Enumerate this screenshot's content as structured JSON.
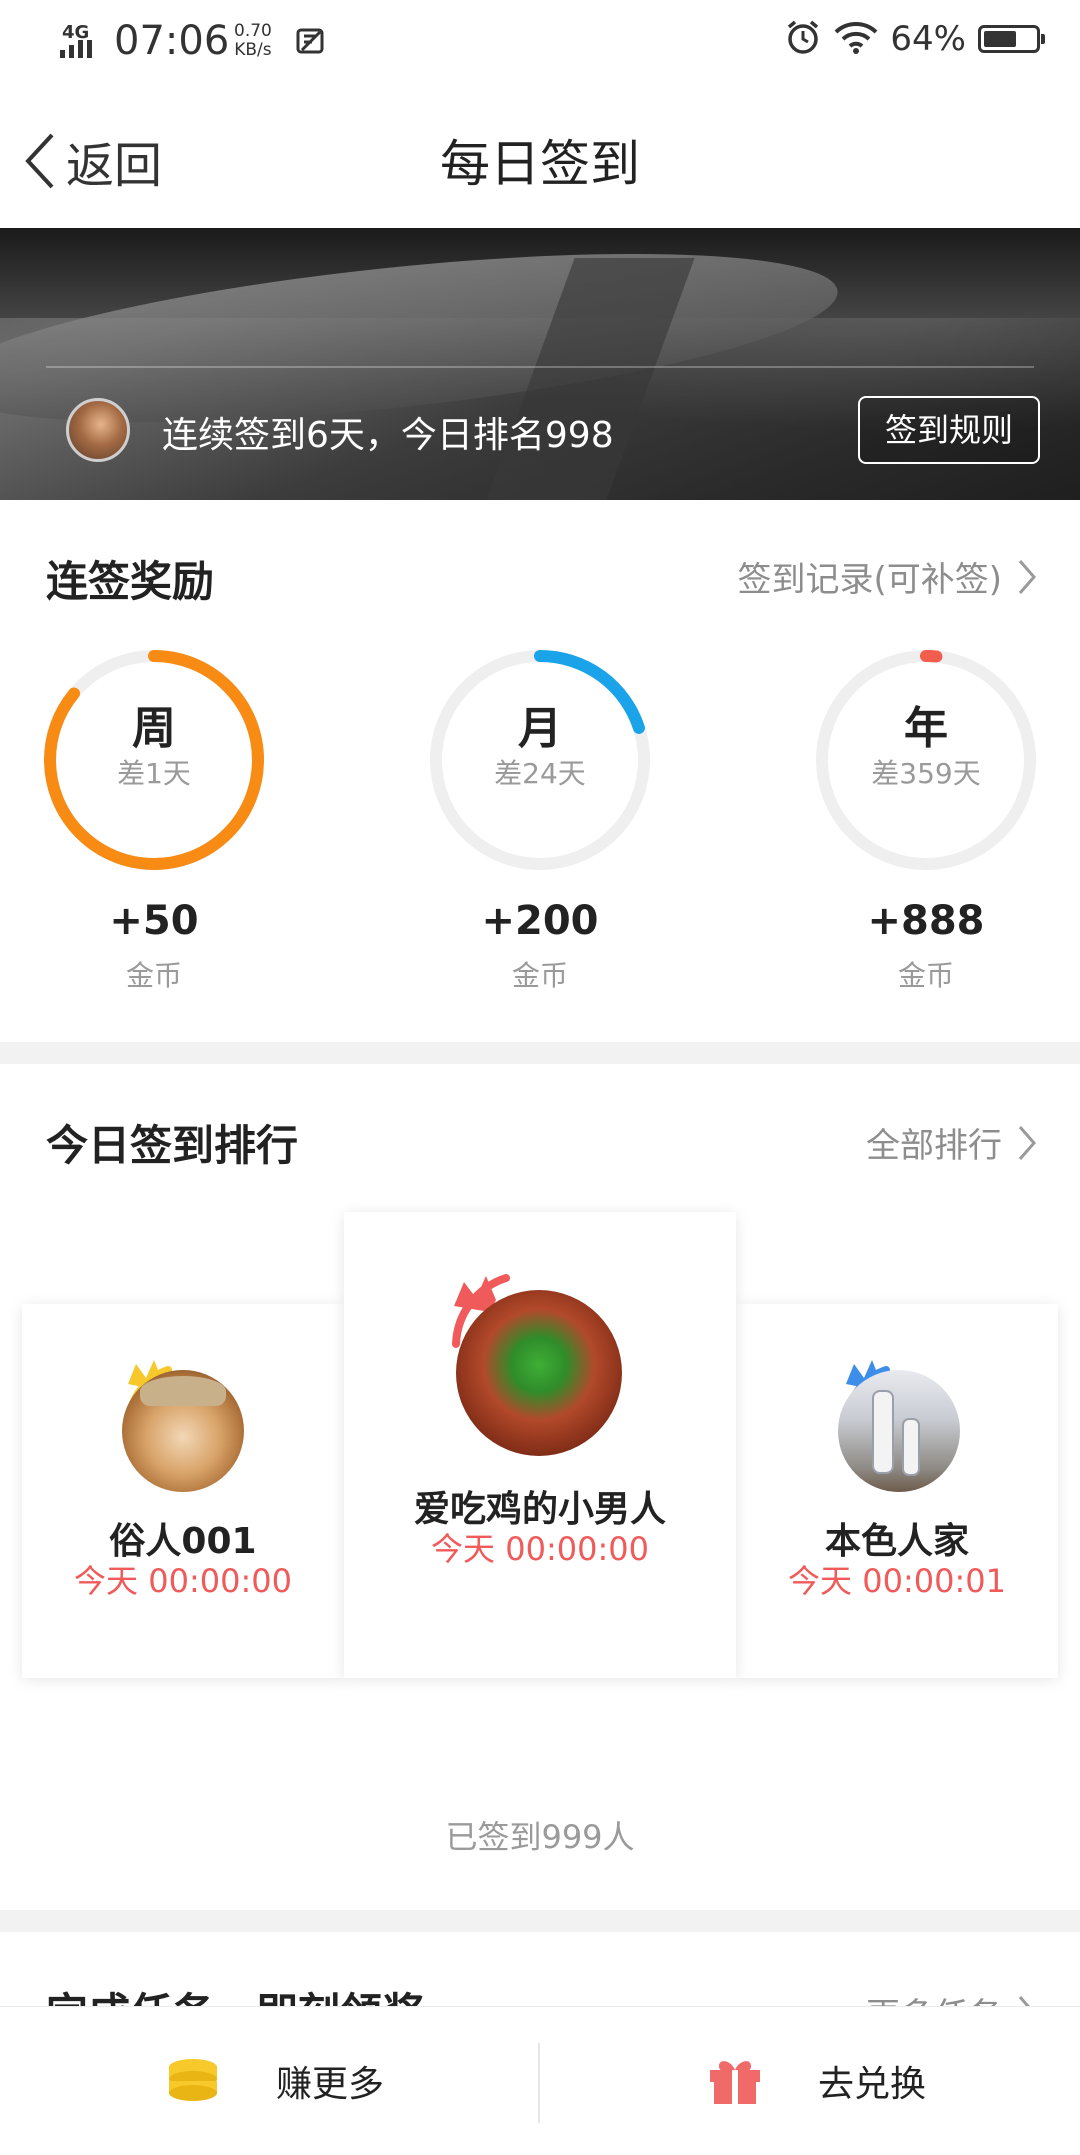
{
  "status_bar": {
    "network": "4G",
    "time": "07:06",
    "speed_value": "0.70",
    "speed_unit": "KB/s",
    "battery": "64%",
    "battery_level": 0.64
  },
  "nav": {
    "back_label": "返回",
    "title": "每日签到"
  },
  "banner": {
    "streak_text": "连续签到6天，今日排名998",
    "rules_button": "签到规则"
  },
  "rewards_section": {
    "title": "连签奖励",
    "link": "签到记录(可补签)",
    "items": [
      {
        "period": "周",
        "remaining": "差1天",
        "amount": "+50",
        "unit": "金币",
        "color": "#f78b14",
        "progress": 0.86
      },
      {
        "period": "月",
        "remaining": "差24天",
        "amount": "+200",
        "unit": "金币",
        "color": "#1aa3e8",
        "progress": 0.2
      },
      {
        "period": "年",
        "remaining": "差359天",
        "amount": "+888",
        "unit": "金币",
        "color": "#f25d4e",
        "progress": 0.016
      }
    ]
  },
  "ranking_section": {
    "title": "今日签到排行",
    "link": "全部排行",
    "first": {
      "name": "爱吃鸡的小男人",
      "time": "今天 00:00:00",
      "crown_color": "#f05a5a"
    },
    "second": {
      "name": "俗人001",
      "time": "今天 00:00:00",
      "crown_color": "#f7c82a"
    },
    "third": {
      "name": "本色人家",
      "time": "今天 00:00:01",
      "crown_color": "#3d8ee8"
    },
    "signed_count": "已签到999人"
  },
  "tasks_section": {
    "title": "完成任务，即刻领奖",
    "link": "更多任务"
  },
  "bottom_bar": {
    "earn_label": "赚更多",
    "exchange_label": "去兑换"
  }
}
